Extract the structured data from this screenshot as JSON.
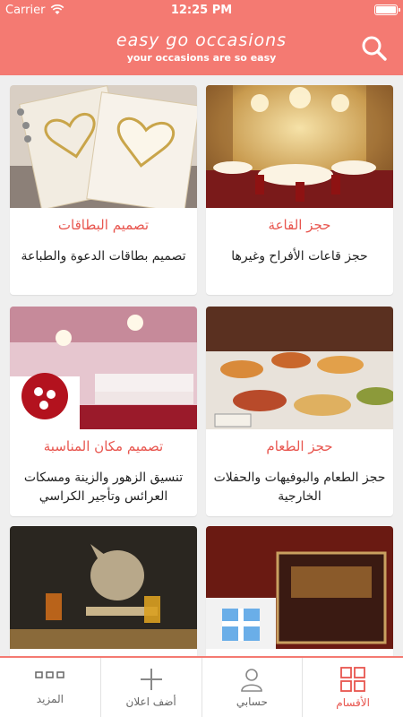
{
  "status": {
    "carrier": "Carrier",
    "time": "12:25 PM"
  },
  "header": {
    "title": "easy go occasions",
    "subtitle": "your occasions are so easy",
    "search_icon": "search-icon"
  },
  "cards": [
    {
      "title": "حجز القاعة",
      "desc": "حجز قاعات الأفراح وغيرها"
    },
    {
      "title": "تصميم البطاقات",
      "desc": "تصميم بطاقات الدعوة والطباعة"
    },
    {
      "title": "حجز الطعام",
      "desc": "حجز الطعام والبوفيهات والحفلات الخارجية"
    },
    {
      "title": "تصميم مكان المناسبة",
      "desc": "تنسيق الزهور والزينة ومسكات العرائس وتأجير الكراسي"
    }
  ],
  "tabs": {
    "more": "المزيد",
    "add_ad": "أضف اعلان",
    "account": "حسابي",
    "sections": "الأقسام"
  },
  "colors": {
    "accent": "#f47a72",
    "title_text": "#e8564f",
    "background": "#efefef"
  }
}
